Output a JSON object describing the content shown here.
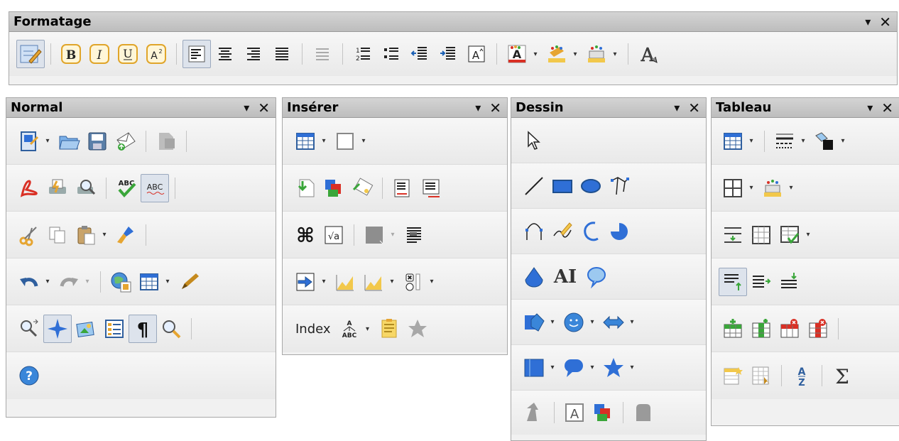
{
  "formatage": {
    "title": "Formatage",
    "menu": "▾",
    "close": "✕"
  },
  "normal": {
    "title": "Normal",
    "menu": "▾",
    "close": "✕"
  },
  "inserer": {
    "title": "Insérer",
    "menu": "▾",
    "close": "✕",
    "index_label": "Index"
  },
  "dessin": {
    "title": "Dessin",
    "menu": "▾",
    "close": "✕",
    "fontwork_label": "AI"
  },
  "tableau": {
    "title": "Tableau",
    "menu": "▾",
    "close": "✕"
  },
  "colors": {
    "title_bg": "#c8c8c8",
    "panel_bg": "#f1f1f1",
    "blue": "#2f6fd6",
    "orange": "#e6a531",
    "red": "#d93025",
    "green": "#3aa63a",
    "yellow": "#f2c84b"
  }
}
